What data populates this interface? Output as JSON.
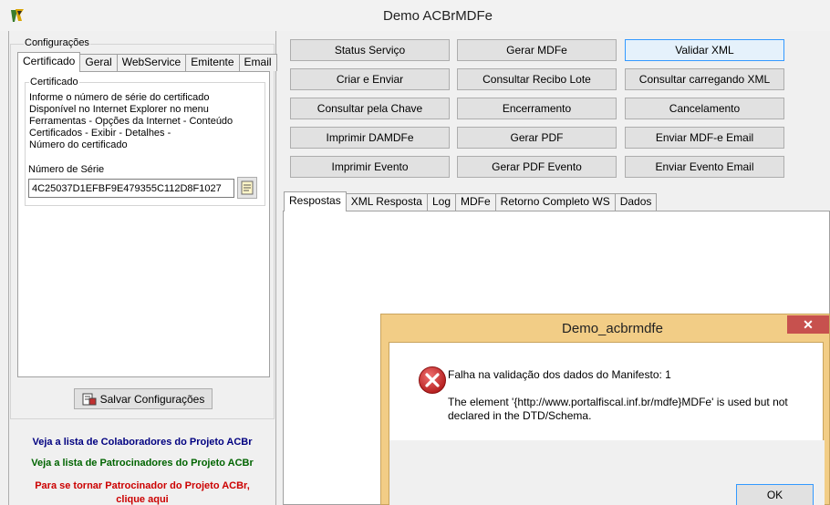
{
  "window": {
    "title": "Demo ACBrMDFe"
  },
  "config": {
    "group_label": "Configurações",
    "tabs": [
      "Certificado",
      "Geral",
      "WebService",
      "Emitente",
      "Email"
    ],
    "cert_group_label": "Certificado",
    "info_lines": [
      "Informe o número de série do certificado",
      "Disponível no Internet Explorer no menu",
      "Ferramentas - Opções da Internet - Conteúdo",
      "Certificados - Exibir - Detalhes -",
      "Número do certificado"
    ],
    "serie_label": "Número de Série",
    "serie_value": "4C25037D1EFBF9E479355C112D8F1027",
    "save_label": "Salvar Configurações"
  },
  "links": {
    "colaboradores": "Veja a lista de Colaboradores do Projeto ACBr",
    "patrocinadores": "Veja a lista de Patrocinadores do Projeto ACBr",
    "patrocinador_1": "Para se tornar Patrocinador do Projeto ACBr,",
    "patrocinador_2": "clique aqui"
  },
  "actions": [
    "Status Serviço",
    "Gerar MDFe",
    "Validar XML",
    "Criar e Enviar",
    "Consultar Recibo Lote",
    "Consultar carregando XML",
    "Consultar pela Chave",
    "Encerramento",
    "Cancelamento",
    "Imprimir DAMDFe",
    "Gerar PDF",
    "Enviar MDF-e Email",
    "Imprimir Evento",
    "Gerar PDF Evento",
    "Enviar Evento Email"
  ],
  "response_tabs": [
    "Respostas",
    "XML Resposta",
    "Log",
    "MDFe",
    "Retorno Completo WS",
    "Dados"
  ],
  "dialog": {
    "title": "Demo_acbrmdfe",
    "close": "✕",
    "message_line1": "Falha na validação dos dados do Manifesto: 1",
    "message_line2": "The element '{http://www.portalfiscal.inf.br/mdfe}MDFe' is used but not declared in the DTD/Schema.",
    "ok_label": "OK",
    "icon": "error-icon"
  },
  "colors": {
    "link_blue": "#000080",
    "link_green": "#006400",
    "link_red": "#cc0000",
    "dialog_frame": "#f2cd86",
    "close_red": "#c7514e"
  }
}
